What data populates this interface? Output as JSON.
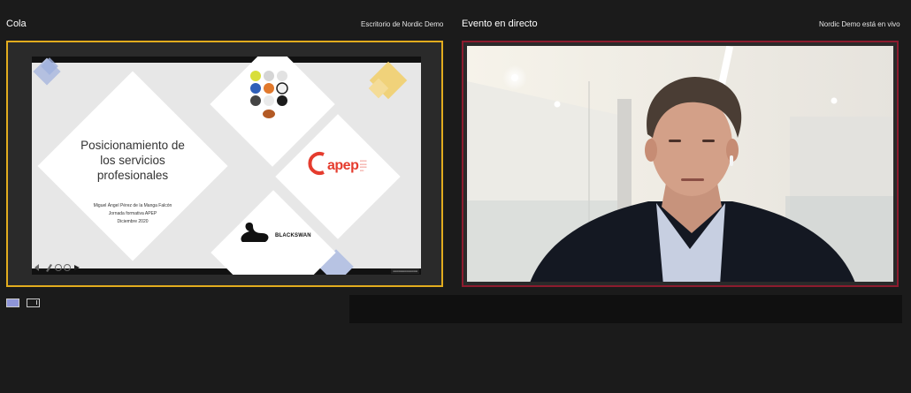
{
  "queue": {
    "title": "Cola",
    "source": "Escritorio de Nordic Demo",
    "slide": {
      "title_lines": [
        "Posicionamiento de",
        "los servicios",
        "profesionales"
      ],
      "author": "Miguel Ángel Pérez de la Manga Falcón",
      "event": "Jornada formativa APEP",
      "date": "Diciembre 2020",
      "apep_logo": "apep",
      "brand_logo": "BLACKSWAN"
    }
  },
  "live": {
    "title": "Evento en directo",
    "status": "Nordic Demo está en vivo"
  },
  "colors": {
    "background": "#1b1b1b",
    "queue_border": "#e2ac1e",
    "live_border": "#8c1b2e",
    "layout_active": "#8e95d8"
  },
  "icons": [
    "layout-single-icon",
    "layout-split-icon",
    "swan-icon",
    "ball-grid-icon"
  ]
}
